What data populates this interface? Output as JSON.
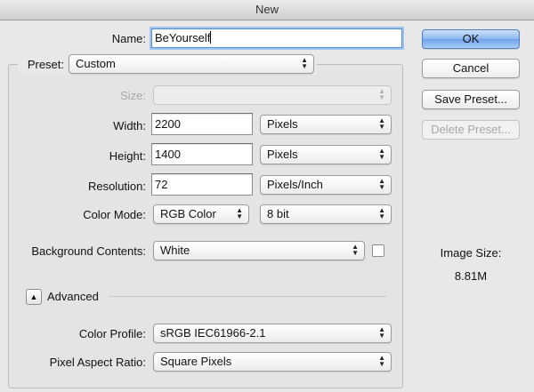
{
  "window": {
    "title": "New"
  },
  "name": {
    "label": "Name:",
    "value": "BeYourself"
  },
  "preset": {
    "label": "Preset:",
    "value": "Custom"
  },
  "size": {
    "label": "Size:",
    "value": ""
  },
  "width": {
    "label": "Width:",
    "value": "2200",
    "unit": "Pixels"
  },
  "height": {
    "label": "Height:",
    "value": "1400",
    "unit": "Pixels"
  },
  "resolution": {
    "label": "Resolution:",
    "value": "72",
    "unit": "Pixels/Inch"
  },
  "color_mode": {
    "label": "Color Mode:",
    "value": "RGB Color",
    "depth": "8 bit"
  },
  "background": {
    "label": "Background Contents:",
    "value": "White"
  },
  "advanced": {
    "label": "Advanced",
    "expanded": true
  },
  "color_profile": {
    "label": "Color Profile:",
    "value": "sRGB IEC61966-2.1"
  },
  "pixel_aspect": {
    "label": "Pixel Aspect Ratio:",
    "value": "Square Pixels"
  },
  "buttons": {
    "ok": "OK",
    "cancel": "Cancel",
    "save_preset": "Save Preset...",
    "delete_preset": "Delete Preset..."
  },
  "image_size": {
    "label": "Image Size:",
    "value": "8.81M"
  },
  "colors": {
    "accent": "#6ea3e9",
    "focus": "#9ec3f0"
  },
  "icons": {
    "popup": "updown-arrows-icon",
    "disclosure": "triangle-up-icon"
  }
}
